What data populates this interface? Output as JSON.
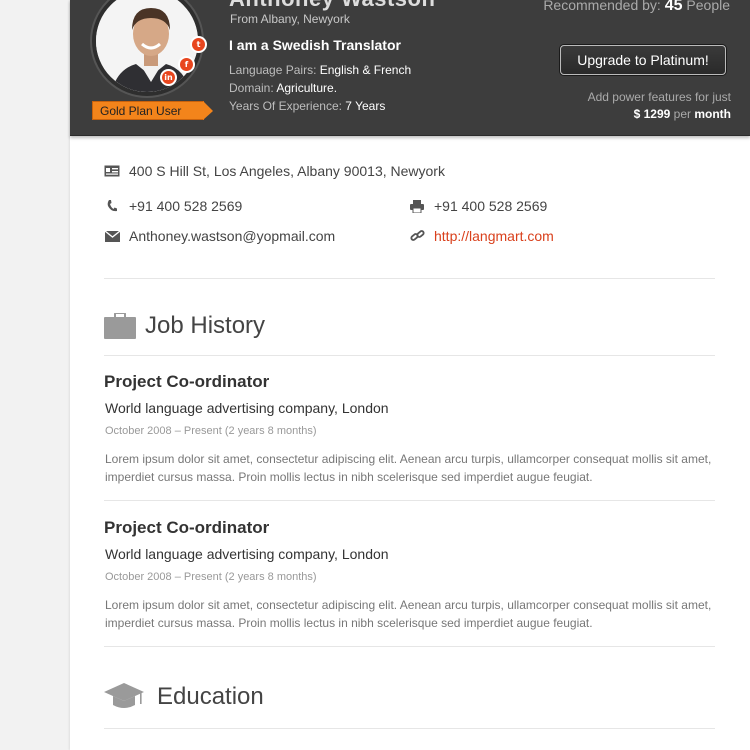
{
  "header": {
    "name": "Anthoney Wastson",
    "from": "From Albany, Newyork",
    "tagline": "I am a Swedish Translator",
    "plan": "Gold Plan User",
    "language_pairs_label": "Language Pairs:",
    "language_pairs_value": "English & French",
    "domain_label": "Domain:",
    "domain_value": "Agriculture.",
    "experience_label": "Years Of Experience:",
    "experience_value": "7 Years",
    "recommended_label": "Recommended by:",
    "recommended_count": "45",
    "recommended_suffix": "People",
    "upgrade_button": "Upgrade to Platinum!",
    "power_text": "Add power features for just",
    "price": "$ 1299",
    "price_per": "per",
    "price_period": "month",
    "social_icons": [
      "twitter-icon",
      "facebook-icon",
      "linkedin-icon"
    ],
    "accent_color": "#e8461f"
  },
  "contact": {
    "address": "400 S Hill St, Los Angeles, Albany 90013, Newyork",
    "phone": "+91 400 528 2569",
    "fax": "+91 400 528 2569",
    "email": "Anthoney.wastson@yopmail.com",
    "website": "http://langmart.com",
    "icons": [
      "address-card-icon",
      "phone-icon",
      "fax-printer-icon",
      "mail-icon",
      "link-icon"
    ]
  },
  "job_history": {
    "title": "Job History",
    "jobs": [
      {
        "title": "Project Co-ordinator",
        "company": "World language advertising company, London",
        "period": "October 2008 – Present (2 years 8 months)",
        "description": "Lorem ipsum dolor sit amet, consectetur adipiscing elit. Aenean arcu turpis, ullamcorper consequat mollis sit amet, imperdiet cursus massa. Proin mollis lectus in nibh scelerisque sed imperdiet augue feugiat."
      },
      {
        "title": "Project Co-ordinator",
        "company": "World language advertising company, London",
        "period": "October 2008 – Present (2 years 8 months)",
        "description": "Lorem ipsum dolor sit amet, consectetur adipiscing elit. Aenean arcu turpis, ullamcorper consequat mollis sit amet, imperdiet cursus massa. Proin mollis lectus in nibh scelerisque sed imperdiet augue feugiat."
      }
    ]
  },
  "education": {
    "title": "Education"
  }
}
